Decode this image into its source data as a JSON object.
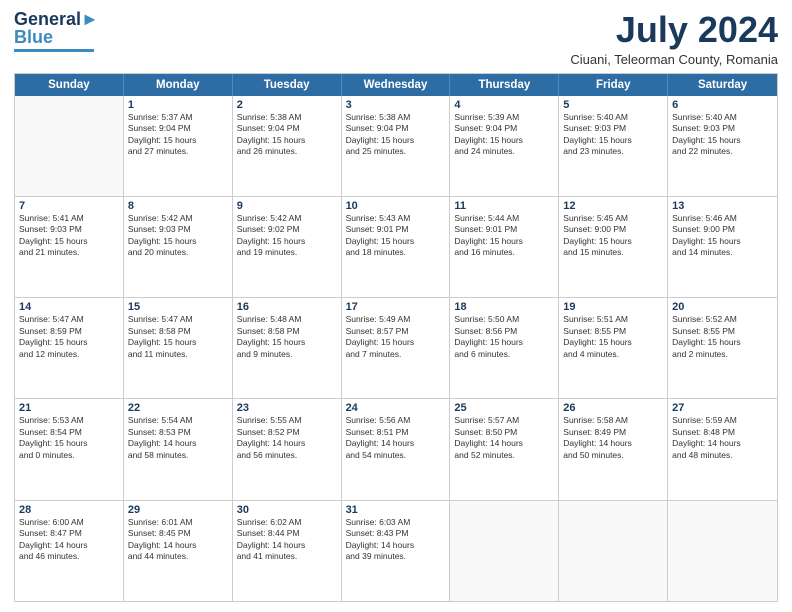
{
  "logo": {
    "line1": "General",
    "line2": "Blue"
  },
  "title": "July 2024",
  "subtitle": "Ciuani, Teleorman County, Romania",
  "header": {
    "days": [
      "Sunday",
      "Monday",
      "Tuesday",
      "Wednesday",
      "Thursday",
      "Friday",
      "Saturday"
    ]
  },
  "rows": [
    [
      {
        "day": "",
        "info": ""
      },
      {
        "day": "1",
        "info": "Sunrise: 5:37 AM\nSunset: 9:04 PM\nDaylight: 15 hours\nand 27 minutes."
      },
      {
        "day": "2",
        "info": "Sunrise: 5:38 AM\nSunset: 9:04 PM\nDaylight: 15 hours\nand 26 minutes."
      },
      {
        "day": "3",
        "info": "Sunrise: 5:38 AM\nSunset: 9:04 PM\nDaylight: 15 hours\nand 25 minutes."
      },
      {
        "day": "4",
        "info": "Sunrise: 5:39 AM\nSunset: 9:04 PM\nDaylight: 15 hours\nand 24 minutes."
      },
      {
        "day": "5",
        "info": "Sunrise: 5:40 AM\nSunset: 9:03 PM\nDaylight: 15 hours\nand 23 minutes."
      },
      {
        "day": "6",
        "info": "Sunrise: 5:40 AM\nSunset: 9:03 PM\nDaylight: 15 hours\nand 22 minutes."
      }
    ],
    [
      {
        "day": "7",
        "info": "Sunrise: 5:41 AM\nSunset: 9:03 PM\nDaylight: 15 hours\nand 21 minutes."
      },
      {
        "day": "8",
        "info": "Sunrise: 5:42 AM\nSunset: 9:03 PM\nDaylight: 15 hours\nand 20 minutes."
      },
      {
        "day": "9",
        "info": "Sunrise: 5:42 AM\nSunset: 9:02 PM\nDaylight: 15 hours\nand 19 minutes."
      },
      {
        "day": "10",
        "info": "Sunrise: 5:43 AM\nSunset: 9:01 PM\nDaylight: 15 hours\nand 18 minutes."
      },
      {
        "day": "11",
        "info": "Sunrise: 5:44 AM\nSunset: 9:01 PM\nDaylight: 15 hours\nand 16 minutes."
      },
      {
        "day": "12",
        "info": "Sunrise: 5:45 AM\nSunset: 9:00 PM\nDaylight: 15 hours\nand 15 minutes."
      },
      {
        "day": "13",
        "info": "Sunrise: 5:46 AM\nSunset: 9:00 PM\nDaylight: 15 hours\nand 14 minutes."
      }
    ],
    [
      {
        "day": "14",
        "info": "Sunrise: 5:47 AM\nSunset: 8:59 PM\nDaylight: 15 hours\nand 12 minutes."
      },
      {
        "day": "15",
        "info": "Sunrise: 5:47 AM\nSunset: 8:58 PM\nDaylight: 15 hours\nand 11 minutes."
      },
      {
        "day": "16",
        "info": "Sunrise: 5:48 AM\nSunset: 8:58 PM\nDaylight: 15 hours\nand 9 minutes."
      },
      {
        "day": "17",
        "info": "Sunrise: 5:49 AM\nSunset: 8:57 PM\nDaylight: 15 hours\nand 7 minutes."
      },
      {
        "day": "18",
        "info": "Sunrise: 5:50 AM\nSunset: 8:56 PM\nDaylight: 15 hours\nand 6 minutes."
      },
      {
        "day": "19",
        "info": "Sunrise: 5:51 AM\nSunset: 8:55 PM\nDaylight: 15 hours\nand 4 minutes."
      },
      {
        "day": "20",
        "info": "Sunrise: 5:52 AM\nSunset: 8:55 PM\nDaylight: 15 hours\nand 2 minutes."
      }
    ],
    [
      {
        "day": "21",
        "info": "Sunrise: 5:53 AM\nSunset: 8:54 PM\nDaylight: 15 hours\nand 0 minutes."
      },
      {
        "day": "22",
        "info": "Sunrise: 5:54 AM\nSunset: 8:53 PM\nDaylight: 14 hours\nand 58 minutes."
      },
      {
        "day": "23",
        "info": "Sunrise: 5:55 AM\nSunset: 8:52 PM\nDaylight: 14 hours\nand 56 minutes."
      },
      {
        "day": "24",
        "info": "Sunrise: 5:56 AM\nSunset: 8:51 PM\nDaylight: 14 hours\nand 54 minutes."
      },
      {
        "day": "25",
        "info": "Sunrise: 5:57 AM\nSunset: 8:50 PM\nDaylight: 14 hours\nand 52 minutes."
      },
      {
        "day": "26",
        "info": "Sunrise: 5:58 AM\nSunset: 8:49 PM\nDaylight: 14 hours\nand 50 minutes."
      },
      {
        "day": "27",
        "info": "Sunrise: 5:59 AM\nSunset: 8:48 PM\nDaylight: 14 hours\nand 48 minutes."
      }
    ],
    [
      {
        "day": "28",
        "info": "Sunrise: 6:00 AM\nSunset: 8:47 PM\nDaylight: 14 hours\nand 46 minutes."
      },
      {
        "day": "29",
        "info": "Sunrise: 6:01 AM\nSunset: 8:45 PM\nDaylight: 14 hours\nand 44 minutes."
      },
      {
        "day": "30",
        "info": "Sunrise: 6:02 AM\nSunset: 8:44 PM\nDaylight: 14 hours\nand 41 minutes."
      },
      {
        "day": "31",
        "info": "Sunrise: 6:03 AM\nSunset: 8:43 PM\nDaylight: 14 hours\nand 39 minutes."
      },
      {
        "day": "",
        "info": ""
      },
      {
        "day": "",
        "info": ""
      },
      {
        "day": "",
        "info": ""
      }
    ]
  ]
}
